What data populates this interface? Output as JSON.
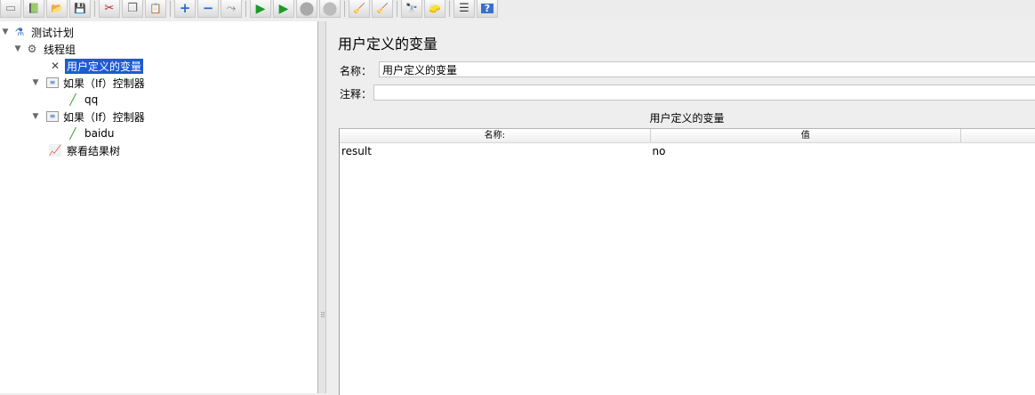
{
  "toolbar": {
    "buttons": [
      {
        "icon": "new-icon",
        "glyph": "▭"
      },
      {
        "icon": "templates-icon",
        "glyph": "📗"
      },
      {
        "icon": "open-icon",
        "glyph": "📂"
      },
      {
        "icon": "save-icon",
        "glyph": "💾"
      },
      {
        "icon": "cut-icon",
        "glyph": "✂"
      },
      {
        "icon": "copy-icon",
        "glyph": "❐"
      },
      {
        "icon": "paste-icon",
        "glyph": "📋"
      },
      {
        "icon": "expand-icon",
        "glyph": "+"
      },
      {
        "icon": "collapse-icon",
        "glyph": "−"
      },
      {
        "icon": "toggle-icon",
        "glyph": "⤳"
      },
      {
        "icon": "start-icon",
        "glyph": "▶"
      },
      {
        "icon": "start-no-pauses-icon",
        "glyph": "▶"
      },
      {
        "icon": "stop-icon",
        "glyph": "⬤"
      },
      {
        "icon": "shutdown-icon",
        "glyph": "⬤"
      },
      {
        "icon": "clear-icon",
        "glyph": "🧹"
      },
      {
        "icon": "clear-all-icon",
        "glyph": "🧹"
      },
      {
        "icon": "search-icon",
        "glyph": "🔭"
      },
      {
        "icon": "reset-search-icon",
        "glyph": "🧽"
      },
      {
        "icon": "function-helper-icon",
        "glyph": "☰"
      },
      {
        "icon": "help-icon",
        "glyph": "?"
      }
    ]
  },
  "tree": {
    "test_plan": "测试计划",
    "thread_group": "线程组",
    "user_vars": "用户定义的变量",
    "if_controller_1": "如果（If）控制器",
    "sampler_qq": "qq",
    "if_controller_2": "如果（If）控制器",
    "sampler_baidu": "baidu",
    "results_tree": "察看结果树"
  },
  "panel": {
    "title": "用户定义的变量",
    "name_label": "名称：",
    "name_value": "用户定义的变量",
    "comment_label": "注释：",
    "comment_value": "",
    "table_title": "用户定义的变量",
    "columns": [
      "名称:",
      "值",
      ""
    ],
    "rows": [
      {
        "name": "result",
        "value": "no",
        "desc": ""
      }
    ]
  },
  "colors": {
    "selection": "#1d5bd6",
    "run_green": "#1a9a2a",
    "expand_blue": "#2a6ad0"
  }
}
